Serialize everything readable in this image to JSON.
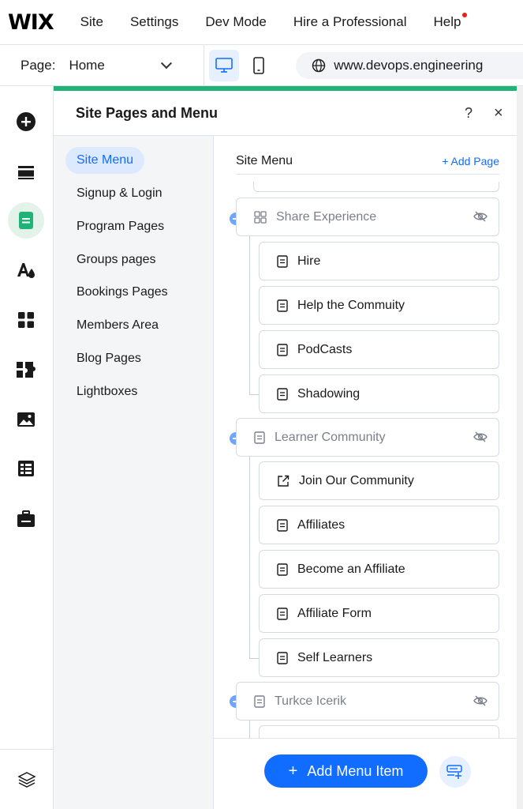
{
  "topbar": {
    "logo": "WIX",
    "nav": [
      "Site",
      "Settings",
      "Dev Mode",
      "Hire a Professional",
      "Help"
    ]
  },
  "secondbar": {
    "page_label": "Page:",
    "page_value": "Home",
    "url": "www.devops.engineering"
  },
  "panel": {
    "title": "Site Pages and Menu",
    "help": "?",
    "close": "×",
    "categories": [
      "Site Menu",
      "Signup & Login",
      "Program Pages",
      "Groups pages",
      "Bookings Pages",
      "Members Area",
      "Blog Pages",
      "Lightboxes"
    ],
    "list_title": "Site Menu",
    "add_page": "+ Add Page",
    "items": [
      {
        "label": "Share Experience",
        "level": 0,
        "icon": "folder-icon",
        "hidden": true
      },
      {
        "label": "Hire",
        "level": 1,
        "icon": "page-icon",
        "hidden": false
      },
      {
        "label": "Help the Commuity",
        "level": 1,
        "icon": "page-icon",
        "hidden": false
      },
      {
        "label": "PodCasts",
        "level": 1,
        "icon": "page-icon",
        "hidden": false
      },
      {
        "label": "Shadowing",
        "level": 1,
        "icon": "page-icon",
        "hidden": false
      },
      {
        "label": "Learner Community",
        "level": 0,
        "icon": "page-icon",
        "hidden": true
      },
      {
        "label": "Join Our Community",
        "level": 1,
        "icon": "external-link-icon",
        "hidden": false
      },
      {
        "label": "Affiliates",
        "level": 1,
        "icon": "page-icon",
        "hidden": false
      },
      {
        "label": "Become an Affiliate",
        "level": 1,
        "icon": "page-icon",
        "hidden": false
      },
      {
        "label": "Affiliate Form",
        "level": 1,
        "icon": "page-icon",
        "hidden": false
      },
      {
        "label": "Self Learners",
        "level": 1,
        "icon": "page-icon",
        "hidden": false
      },
      {
        "label": "Turkce Icerik",
        "level": 0,
        "icon": "page-icon",
        "hidden": true
      }
    ],
    "add_menu_item": "Add Menu Item"
  },
  "colors": {
    "accent": "#116dff",
    "green": "#1fb378"
  }
}
